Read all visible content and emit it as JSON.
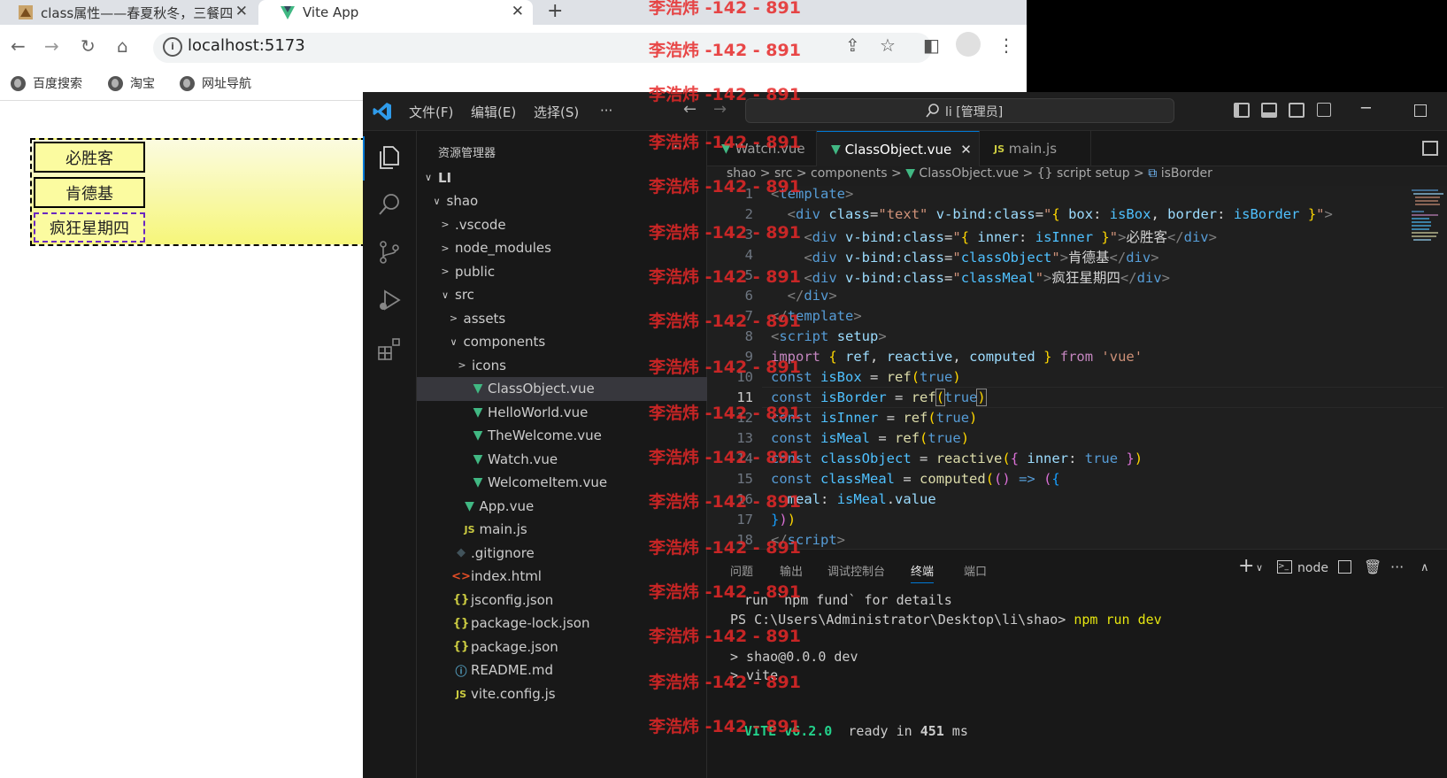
{
  "browser": {
    "tabs": [
      {
        "title": "class属性——春夏秋冬，三餐四"
      },
      {
        "title": "Vite App"
      }
    ],
    "url": "localhost:5173",
    "bookmarks": [
      "百度搜索",
      "淘宝",
      "网址导航"
    ]
  },
  "page": {
    "divs": [
      "必胜客",
      "肯德基",
      "疯狂星期四"
    ]
  },
  "vscode": {
    "menu": [
      "文件(F)",
      "编辑(E)",
      "选择(S)",
      "···"
    ],
    "search": "li [管理员]",
    "explorer_title": "资源管理器",
    "explorer_more": "···",
    "tree": [
      {
        "label": "LI",
        "depth": 0,
        "tw": "∨",
        "icon": ""
      },
      {
        "label": "shao",
        "depth": 1,
        "tw": "∨",
        "icon": ""
      },
      {
        "label": ".vscode",
        "depth": 2,
        "tw": ">",
        "icon": ""
      },
      {
        "label": "node_modules",
        "depth": 2,
        "tw": ">",
        "icon": ""
      },
      {
        "label": "public",
        "depth": 2,
        "tw": ">",
        "icon": ""
      },
      {
        "label": "src",
        "depth": 2,
        "tw": "∨",
        "icon": ""
      },
      {
        "label": "assets",
        "depth": 3,
        "tw": ">",
        "icon": ""
      },
      {
        "label": "components",
        "depth": 3,
        "tw": "∨",
        "icon": ""
      },
      {
        "label": "icons",
        "depth": 4,
        "tw": ">",
        "icon": ""
      },
      {
        "label": "ClassObject.vue",
        "depth": 4,
        "tw": "",
        "icon": "vue",
        "selected": true
      },
      {
        "label": "HelloWorld.vue",
        "depth": 4,
        "tw": "",
        "icon": "vue"
      },
      {
        "label": "TheWelcome.vue",
        "depth": 4,
        "tw": "",
        "icon": "vue"
      },
      {
        "label": "Watch.vue",
        "depth": 4,
        "tw": "",
        "icon": "vue"
      },
      {
        "label": "WelcomeItem.vue",
        "depth": 4,
        "tw": "",
        "icon": "vue"
      },
      {
        "label": "App.vue",
        "depth": 3,
        "tw": "",
        "icon": "vue"
      },
      {
        "label": "main.js",
        "depth": 3,
        "tw": "",
        "icon": "js"
      },
      {
        "label": ".gitignore",
        "depth": 2,
        "tw": "",
        "icon": "git"
      },
      {
        "label": "index.html",
        "depth": 2,
        "tw": "",
        "icon": "html"
      },
      {
        "label": "jsconfig.json",
        "depth": 2,
        "tw": "",
        "icon": "json"
      },
      {
        "label": "package-lock.json",
        "depth": 2,
        "tw": "",
        "icon": "json"
      },
      {
        "label": "package.json",
        "depth": 2,
        "tw": "",
        "icon": "json"
      },
      {
        "label": "README.md",
        "depth": 2,
        "tw": "",
        "icon": "md"
      },
      {
        "label": "vite.config.js",
        "depth": 2,
        "tw": "",
        "icon": "js"
      }
    ],
    "editor_tabs": [
      {
        "label": "Watch.vue",
        "icon": "vue"
      },
      {
        "label": "ClassObject.vue",
        "icon": "vue",
        "active": true
      },
      {
        "label": "main.js",
        "icon": "js"
      }
    ],
    "breadcrumb": [
      "shao",
      "src",
      "components",
      "ClassObject.vue",
      "{} script setup",
      "isBorder"
    ],
    "line_numbers": [
      "1",
      "2",
      "3",
      "4",
      "5",
      "6",
      "7",
      "8",
      "9",
      "10",
      "11",
      "12",
      "13",
      "14",
      "15",
      "16",
      "17",
      "18"
    ],
    "current_line": "11",
    "panel_tabs": [
      "问题",
      "输出",
      "调试控制台",
      "终端",
      "端口"
    ],
    "active_panel_tab": "终端",
    "terminal_shell": "node",
    "terminal": {
      "l1": "run `npm fund` for details",
      "l2_prompt": "PS C:\\Users\\Administrator\\Desktop\\li\\shao> ",
      "l2_cmd": "npm run dev",
      "l3": "> shao@0.0.0 dev",
      "l4": "> vite",
      "l5_vite": "VITE v6.2.0",
      "l5_rest": "ready in ",
      "l5_ms": "451",
      "l5_unit": " ms"
    }
  },
  "watermark": "李浩炜 -142 - 891",
  "colors": {
    "vscode_bg": "#1e1e1e",
    "accent": "#0078d4",
    "vue_green": "#41b883",
    "watermark_red": "#e62828"
  }
}
